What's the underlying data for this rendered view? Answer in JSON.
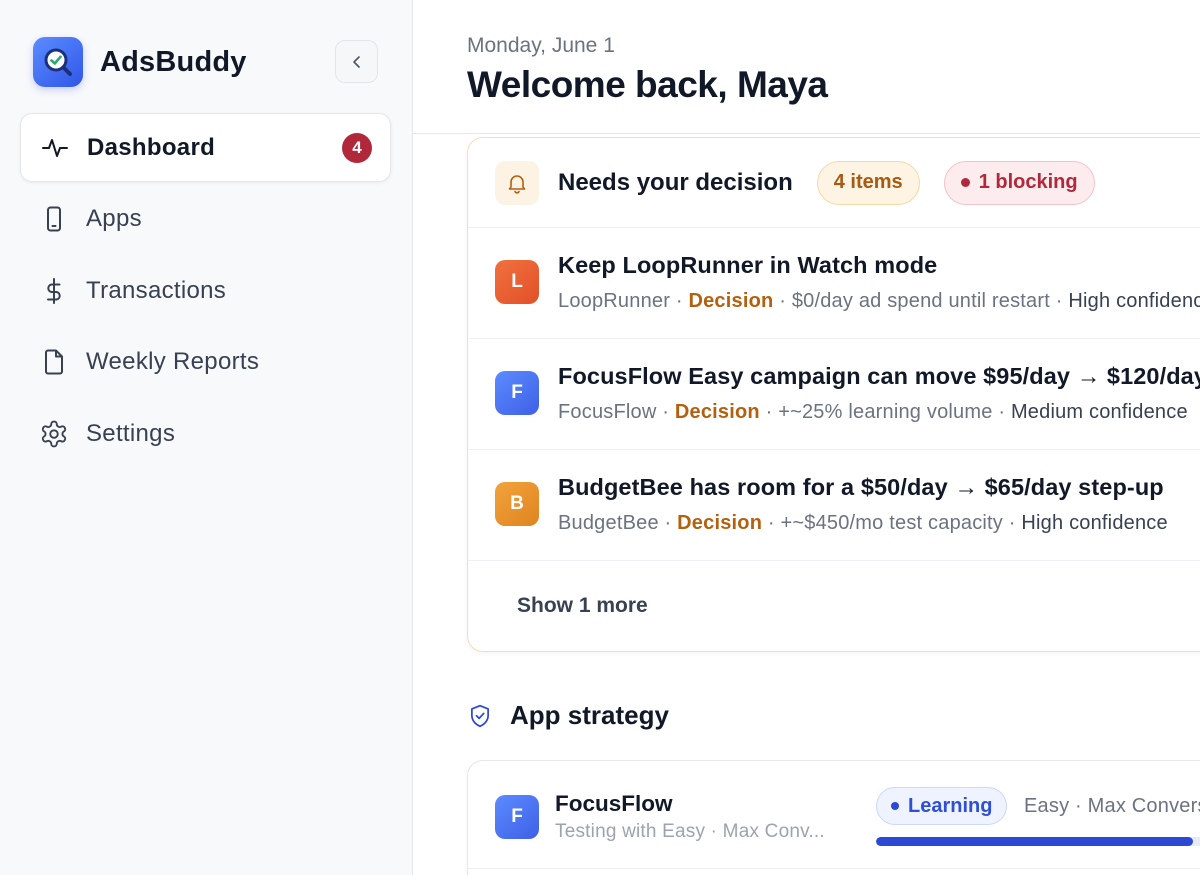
{
  "app": {
    "name": "AdsBuddy",
    "logo_icon": "search-check-icon",
    "accent": "#3b5cf0"
  },
  "sidebar": {
    "collapse_icon": "chevron-left-icon",
    "items": [
      {
        "label": "Dashboard",
        "icon": "activity-icon",
        "active": true,
        "badge": "4"
      },
      {
        "label": "Apps",
        "icon": "phone-icon",
        "active": false
      },
      {
        "label": "Transactions",
        "icon": "dollar-icon",
        "active": false
      },
      {
        "label": "Weekly Reports",
        "icon": "file-icon",
        "active": false
      },
      {
        "label": "Settings",
        "icon": "gear-icon",
        "active": false
      }
    ]
  },
  "header": {
    "date": "Monday, June 1",
    "welcome": "Welcome back, Maya"
  },
  "decisions": {
    "title": "Needs your decision",
    "count_label": "4 items",
    "blocking_label": "1 blocking",
    "rows": [
      {
        "initial": "L",
        "color": "#ec5f2f",
        "title": "Keep LoopRunner in Watch mode",
        "app": "LoopRunner",
        "tag": "Decision",
        "impact": "$0/day ad spend until restart",
        "confidence": "High confidence"
      },
      {
        "initial": "F",
        "color": "#4a7bf2",
        "title": "FocusFlow Easy campaign can move $95/day → $120/day",
        "app": "FocusFlow",
        "tag": "Decision",
        "impact": "+~25% learning volume",
        "confidence": "Medium confidence"
      },
      {
        "initial": "B",
        "color": "#e8952d",
        "title": "BudgetBee has room for a $50/day → $65/day step-up",
        "app": "BudgetBee",
        "tag": "Decision",
        "impact": "+~$450/mo test capacity",
        "confidence": "High confidence"
      }
    ],
    "show_more": "Show 1 more"
  },
  "strategy": {
    "title": "App strategy",
    "icon": "shield-check-icon",
    "apps": [
      {
        "initial": "F",
        "name": "FocusFlow",
        "subtitle": "Testing with Easy · Max Conv...",
        "status": "Learning",
        "mode": "Easy · Max Conversions",
        "progress": 0.9
      }
    ]
  }
}
